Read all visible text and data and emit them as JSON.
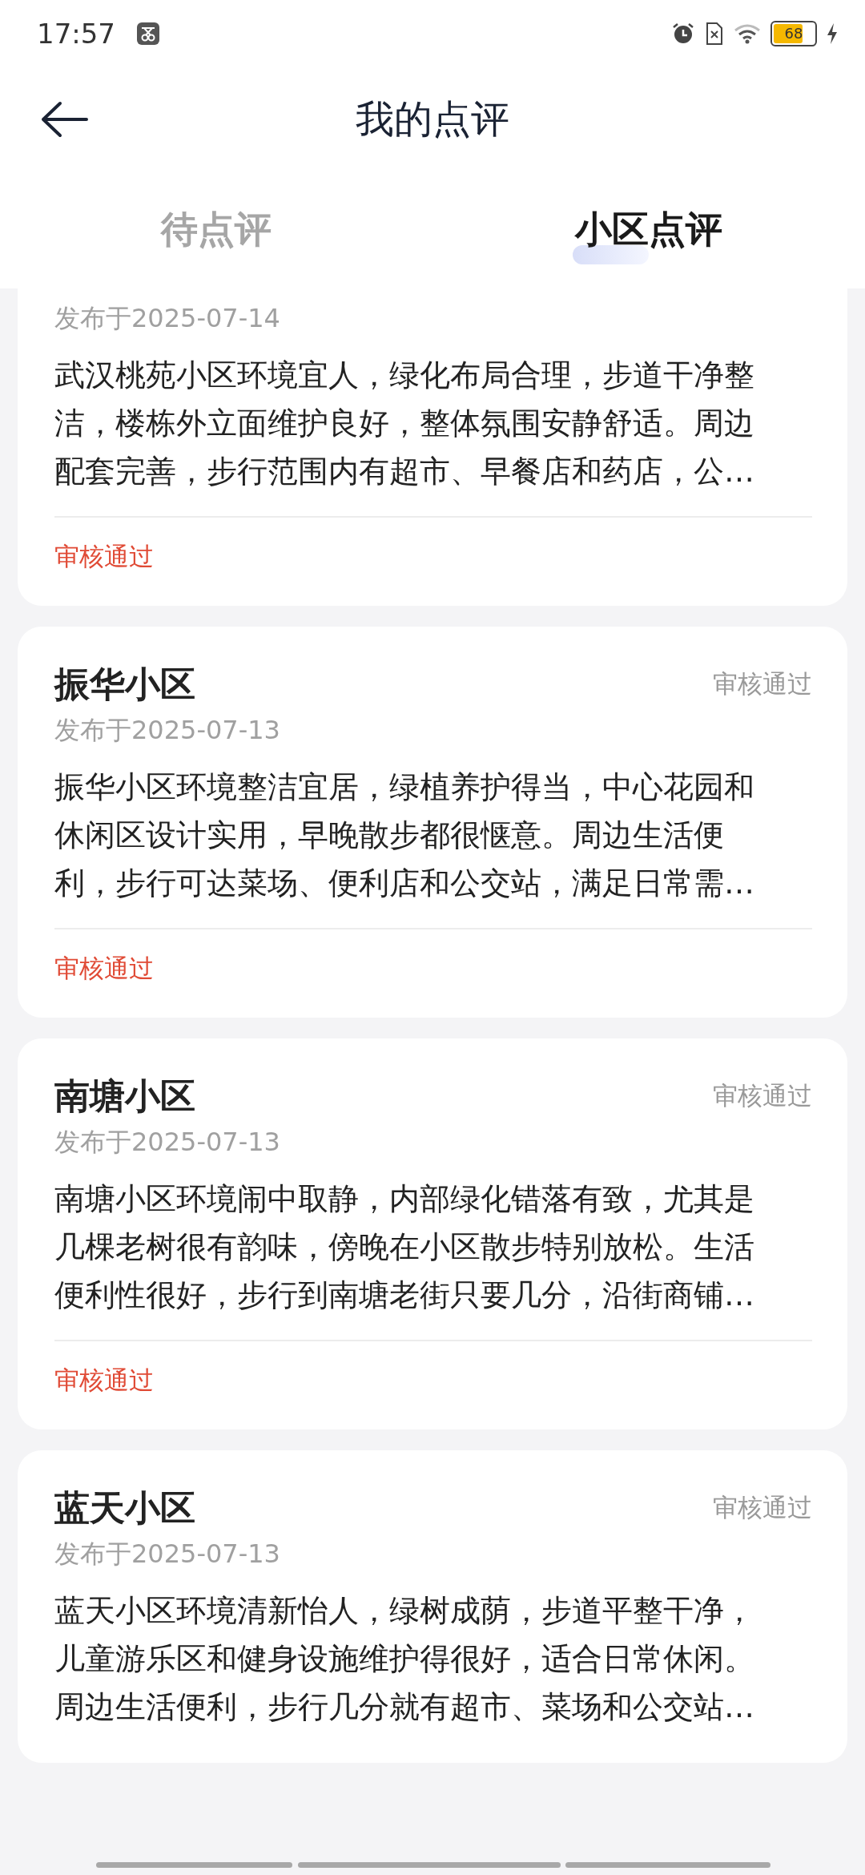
{
  "status_bar": {
    "time": "17:57",
    "battery": "68"
  },
  "header": {
    "title": "我的点评"
  },
  "tabs": [
    {
      "label": "待点评",
      "selected": false
    },
    {
      "label": "小区点评",
      "selected": true
    }
  ],
  "reviews": [
    {
      "date": "发布于2025-07-14",
      "body": "武汉桃苑小区环境宜人，绿化布局合理，步道干净整洁，楼栋外立面维护良好，整体氛围安静舒适。周边配套完善，步行范围内有超市、早餐店和药店，公…",
      "status": "审核通过"
    },
    {
      "title": "振华小区",
      "status_top": "审核通过",
      "date": "发布于2025-07-13",
      "body": "振华小区环境整洁宜居，绿植养护得当，中心花园和休闲区设计实用，早晚散步都很惬意。周边生活便利，步行可达菜场、便利店和公交站，满足日常需…",
      "status": "审核通过"
    },
    {
      "title": "南塘小区",
      "status_top": "审核通过",
      "date": "发布于2025-07-13",
      "body": "南塘小区环境闹中取静，内部绿化错落有致，尤其是几棵老树很有韵味，傍晚在小区散步特别放松。生活便利性很好，步行到南塘老街只要几分，沿街商铺…",
      "status": "审核通过"
    },
    {
      "title": "蓝天小区",
      "status_top": "审核通过",
      "date": "发布于2025-07-13",
      "body": "蓝天小区环境清新怡人，绿树成荫，步道平整干净，儿童游乐区和健身设施维护得很好，适合日常休闲。周边生活便利，步行几分就有超市、菜场和公交站…"
    }
  ]
}
